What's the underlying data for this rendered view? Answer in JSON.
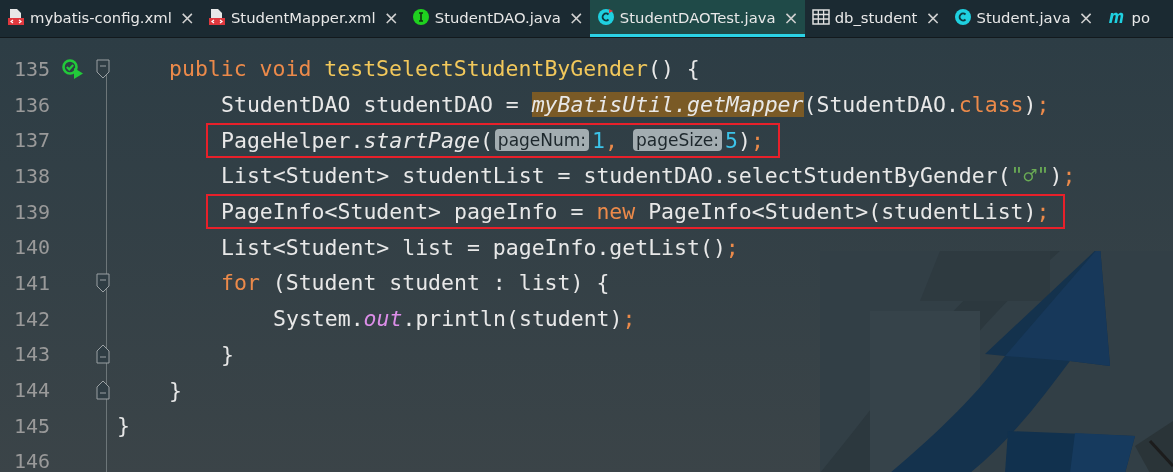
{
  "tabs": [
    {
      "label": "mybatis-config.xml",
      "kind": "xml",
      "selected": false,
      "closable": true
    },
    {
      "label": "StudentMapper.xml",
      "kind": "xml",
      "selected": false,
      "closable": true
    },
    {
      "label": "StudentDAO.java",
      "kind": "interface",
      "selected": false,
      "closable": true
    },
    {
      "label": "StudentDAOTest.java",
      "kind": "test",
      "selected": true,
      "closable": true
    },
    {
      "label": "db_student",
      "kind": "table",
      "selected": false,
      "closable": true
    },
    {
      "label": "Student.java",
      "kind": "class",
      "selected": false,
      "closable": true
    },
    {
      "label": "po",
      "kind": "maven",
      "selected": false,
      "closable": false
    }
  ],
  "close_glyph": "×",
  "editor": {
    "lines": [
      {
        "number": "135",
        "run_button": true,
        "fold_start": true,
        "fold_end": false,
        "boxed": false,
        "tokens": [
          {
            "text": "public void ",
            "kind": "keyword"
          },
          {
            "text": "testSelectStudentByGender",
            "kind": "declaration"
          },
          {
            "text": "() {",
            "kind": "plain"
          }
        ]
      },
      {
        "number": "136",
        "run_button": false,
        "fold_start": false,
        "fold_end": false,
        "boxed": false,
        "tokens": [
          {
            "text": "StudentDAO studentDAO = ",
            "kind": "plain"
          },
          {
            "text": "myBatisUtil.getMapper",
            "kind": "static-highlight"
          },
          {
            "text": "(StudentDAO.",
            "kind": "plain"
          },
          {
            "text": "class",
            "kind": "keyword"
          },
          {
            "text": ")",
            "kind": "plain"
          },
          {
            "text": ";",
            "kind": "semicolon"
          }
        ]
      },
      {
        "number": "137",
        "run_button": false,
        "fold_start": false,
        "fold_end": false,
        "boxed": true,
        "tokens": [
          {
            "text": "PageHelper.",
            "kind": "plain"
          },
          {
            "text": "startPage",
            "kind": "static"
          },
          {
            "text": "(",
            "kind": "plain"
          },
          {
            "text": "pageNum:",
            "kind": "hint"
          },
          {
            "text": "1",
            "kind": "number"
          },
          {
            "text": ", ",
            "kind": "semicolon"
          },
          {
            "text": "pageSize:",
            "kind": "hint"
          },
          {
            "text": "5",
            "kind": "number"
          },
          {
            "text": ")",
            "kind": "plain"
          },
          {
            "text": ";",
            "kind": "semicolon"
          }
        ]
      },
      {
        "number": "138",
        "run_button": false,
        "fold_start": false,
        "fold_end": false,
        "boxed": false,
        "tokens": [
          {
            "text": "List<Student> studentList = studentDAO.selectStudentByGender(",
            "kind": "plain"
          },
          {
            "text": "\"♂\"",
            "kind": "string"
          },
          {
            "text": ")",
            "kind": "plain"
          },
          {
            "text": ";",
            "kind": "semicolon"
          }
        ]
      },
      {
        "number": "139",
        "run_button": false,
        "fold_start": false,
        "fold_end": false,
        "boxed": true,
        "tokens": [
          {
            "text": "PageInfo<Student> pageInfo = ",
            "kind": "plain"
          },
          {
            "text": "new ",
            "kind": "keyword"
          },
          {
            "text": "PageInfo<Student>(studentList)",
            "kind": "plain"
          },
          {
            "text": ";",
            "kind": "semicolon"
          }
        ]
      },
      {
        "number": "140",
        "run_button": false,
        "fold_start": false,
        "fold_end": false,
        "boxed": false,
        "tokens": [
          {
            "text": "List<Student> list = pageInfo.getList()",
            "kind": "plain"
          },
          {
            "text": ";",
            "kind": "semicolon"
          }
        ]
      },
      {
        "number": "141",
        "run_button": false,
        "fold_start": true,
        "fold_end": false,
        "boxed": false,
        "tokens": [
          {
            "text": "for ",
            "kind": "keyword"
          },
          {
            "text": "(Student student : list) {",
            "kind": "plain"
          }
        ]
      },
      {
        "number": "142",
        "run_button": false,
        "fold_start": false,
        "fold_end": false,
        "boxed": false,
        "tokens": [
          {
            "text": "System.",
            "kind": "plain"
          },
          {
            "text": "out",
            "kind": "static-field"
          },
          {
            "text": ".println(student)",
            "kind": "plain"
          },
          {
            "text": ";",
            "kind": "semicolon"
          }
        ]
      },
      {
        "number": "143",
        "run_button": false,
        "fold_start": false,
        "fold_end": true,
        "boxed": false,
        "tokens": [
          {
            "text": "}",
            "kind": "plain"
          }
        ]
      },
      {
        "number": "144",
        "run_button": false,
        "fold_start": false,
        "fold_end": true,
        "boxed": false,
        "tokens": [
          {
            "text": "}",
            "kind": "plain"
          }
        ]
      },
      {
        "number": "145",
        "run_button": false,
        "fold_start": false,
        "fold_end": false,
        "boxed": false,
        "tokens": [
          {
            "text": "}",
            "kind": "plain"
          }
        ]
      },
      {
        "number": "146",
        "run_button": false,
        "fold_start": false,
        "fold_end": false
      }
    ]
  }
}
